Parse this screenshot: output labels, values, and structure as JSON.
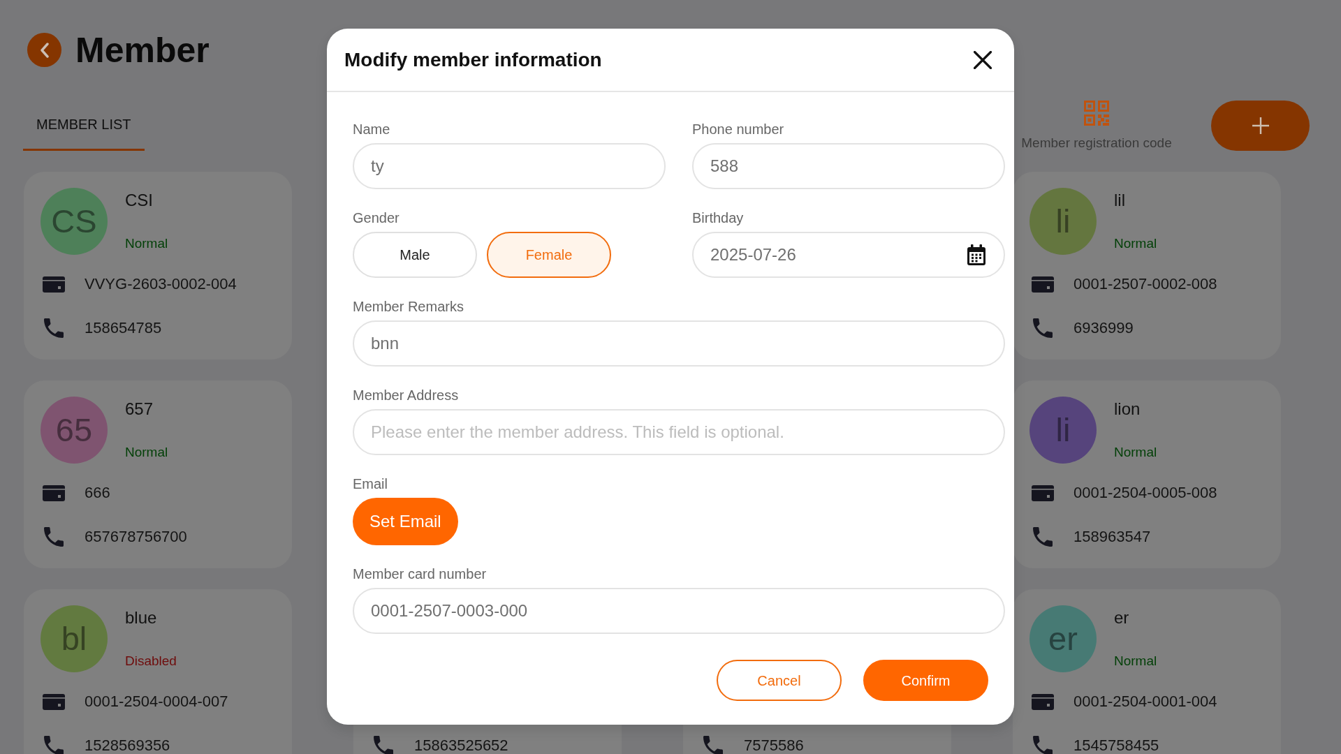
{
  "header": {
    "title": "Member",
    "tabs": [
      {
        "label": "MEMBER LIST",
        "selected": true
      }
    ],
    "registration_code": "Member registration code"
  },
  "member_rows": [
    [
      {
        "initials": "CS",
        "color": "#4e8059",
        "name": "CSI",
        "status": {
          "text": "Normal",
          "kind": "normal"
        },
        "card_number": "VVYG-2603-0002-004",
        "phone": "158654785"
      },
      {
        "initials": "li",
        "color": "#64763f",
        "name": "lil",
        "status": {
          "text": "Normal",
          "kind": "normal"
        },
        "card_number": "0001-2507-0002-008",
        "phone": "6936999"
      }
    ],
    [
      {
        "initials": "65",
        "color": "#7f5470",
        "name": "657",
        "status": {
          "text": "Normal",
          "kind": "normal"
        },
        "card_number": "666",
        "phone": "657678756700"
      },
      {
        "initials": "li",
        "color": "#56447c",
        "name": "lion",
        "status": {
          "text": "Normal",
          "kind": "normal"
        },
        "card_number": "0001-2504-0005-008",
        "phone": "158963547"
      }
    ],
    [
      {
        "initials": "bl",
        "color": "#627a40",
        "name": "blue",
        "status": {
          "text": "Disabled",
          "kind": "disabled"
        },
        "card_number": "0001-2504-0004-007",
        "phone": "1528569356"
      },
      {
        "phone": "15863525652"
      },
      {
        "phone": "7575586"
      },
      {
        "initials": "er",
        "color": "#477a74",
        "name": "er",
        "status": {
          "text": "Normal",
          "kind": "normal"
        },
        "card_number": "0001-2504-0001-004",
        "phone": "1545758455"
      }
    ]
  ],
  "dialog": {
    "title": "Modify member information",
    "rows": [
      [
        {
          "kind": "text",
          "label": "Name",
          "value": "ty"
        },
        {
          "kind": "text",
          "label": "Phone number",
          "value": "588"
        }
      ],
      [
        {
          "kind": "choice",
          "label": "Gender",
          "options": [
            {
              "label": "Male",
              "selected": false
            },
            {
              "label": "Female",
              "selected": true
            }
          ]
        },
        {
          "kind": "date",
          "label": "Birthday",
          "value": "2025-07-26"
        }
      ],
      [
        {
          "kind": "text",
          "label": "Member Remarks",
          "value": "bnn"
        }
      ],
      [
        {
          "kind": "text",
          "label": "Member Address",
          "placeholder": "Please enter the member address. This field is optional."
        }
      ],
      [
        {
          "kind": "button",
          "label": "Email",
          "button": "Set Email"
        }
      ],
      [
        {
          "kind": "text",
          "label": "Member card number",
          "value": "0001-2507-0003-000"
        }
      ]
    ],
    "buttons": [
      {
        "label": "Cancel",
        "kind": "secondary"
      },
      {
        "label": "Confirm",
        "kind": "primary"
      }
    ]
  }
}
